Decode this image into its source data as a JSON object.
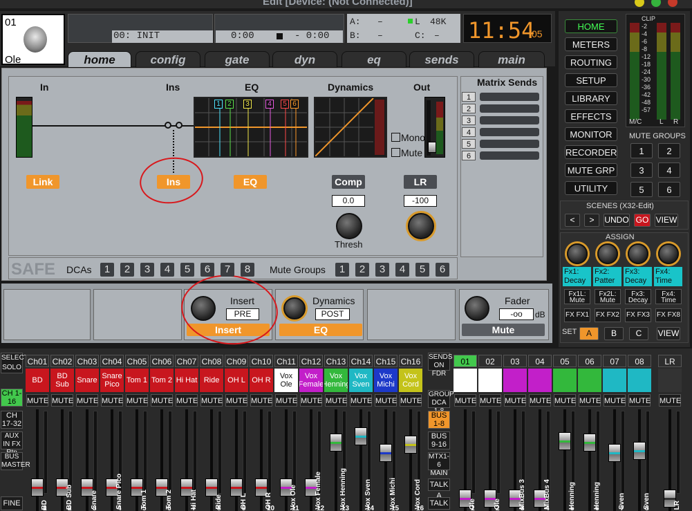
{
  "window": {
    "title": "Edit [Device: (Not Connected)]"
  },
  "channel": {
    "number": "01",
    "name": "Ole"
  },
  "display": {
    "scene": "00: INIT",
    "time_left": "0:00",
    "time_right": "- 0:00",
    "a_label": "A:",
    "a_value": "–",
    "b_label": "B:",
    "b_value": "–",
    "l_label": "L",
    "rate": "48K",
    "c_label": "C:",
    "c_value": "–",
    "clock": "11:54",
    "clock_sec": "05"
  },
  "tabs": [
    "home",
    "config",
    "gate",
    "dyn",
    "eq",
    "sends",
    "main"
  ],
  "home": {
    "in": "In",
    "ins": "Ins",
    "eq": "EQ",
    "dynamics": "Dynamics",
    "out": "Out",
    "link_btn": "Link",
    "ins_btn": "Ins",
    "eq_btn": "EQ",
    "mono": "Mono",
    "mute": "Mute",
    "comp_btn": "Comp",
    "comp_val": "0.0",
    "thresh": "Thresh",
    "lr_btn": "LR",
    "lr_val": "-100",
    "eq_bands": [
      "1",
      "2",
      "3",
      "4",
      "5",
      "6"
    ],
    "safe": "SAFE",
    "dcas_label": "DCAs",
    "dcas": [
      "1",
      "2",
      "3",
      "4",
      "5",
      "6",
      "7",
      "8"
    ],
    "mute_groups_label": "Mute Groups",
    "mute_groups": [
      "1",
      "2",
      "3",
      "4",
      "5",
      "6"
    ]
  },
  "matrix": {
    "title": "Matrix Sends",
    "items": [
      "1",
      "2",
      "3",
      "4",
      "5",
      "6"
    ]
  },
  "strip_bar": {
    "insert_title": "Insert",
    "insert_mode": "PRE",
    "insert_btn": "Insert",
    "dyn_title": "Dynamics",
    "dyn_mode": "POST",
    "dyn_btn": "EQ",
    "fader_title": "Fader",
    "fader_val": "-oo",
    "fader_unit": "dB",
    "mute_btn": "Mute"
  },
  "sidebar": {
    "buttons": [
      "HOME",
      "METERS",
      "ROUTING",
      "SETUP",
      "LIBRARY",
      "EFFECTS",
      "MONITOR",
      "RECORDER",
      "MUTE GRP",
      "UTILITY"
    ],
    "clip": "CLIP",
    "meter_ticks": [
      "-2",
      "-4",
      "-6",
      "-8",
      "-12",
      "-18",
      "-24",
      "-30",
      "-36",
      "-42",
      "-48",
      "-57"
    ],
    "meter_labels": [
      "M/C",
      "L",
      "R"
    ],
    "mute_groups_title": "MUTE GROUPS",
    "mute_groups": [
      "1",
      "2",
      "3",
      "4",
      "5",
      "6"
    ],
    "scenes_title": "SCENES (X32-Edit)",
    "scene_btns": [
      "<",
      ">",
      "UNDO",
      "GO",
      "VIEW"
    ],
    "assign_title": "ASSIGN",
    "fx_labels": [
      "Fx1: Decay",
      "Fx2: Patter",
      "Fx3: Decay",
      "Fx4: Time"
    ],
    "fx_small": [
      "Fx1L: Mute",
      "Fx2L: Mute",
      "Fx3: Decay",
      "Fx4: Time"
    ],
    "fx_btns": [
      "FX FX1",
      "FX FX2",
      "FX FX3",
      "FX FX8"
    ],
    "set_label": "SET",
    "set_btns": [
      "A",
      "B",
      "C"
    ],
    "set_view": "VIEW"
  },
  "mixer_left": {
    "select_solo": "SELECT SOLO",
    "ch1_16": "CH 1-16",
    "ch17_32": "CH 17-32",
    "aux": "AUX IN FX Rtn",
    "bus_master": "BUS MASTER",
    "fine": "FINE"
  },
  "mixer_center": {
    "sends_on_fdr": "SENDS ON FDR",
    "group_dca": "GROUP DCA 1-8",
    "bus_1_8": "BUS 1-8",
    "bus_9_16": "BUS 9-16",
    "mtx": "MTX1-6 MAIN C",
    "talk_a": "TALK A",
    "talk_b": "TALK B"
  },
  "mute_label": "MUTE",
  "channels": [
    {
      "id": "Ch01",
      "name": "BD",
      "v": "BD",
      "c": "#c8161e",
      "n": "1",
      "f": 0.15
    },
    {
      "id": "Ch02",
      "name": "BD Sub",
      "v": "BD Sub",
      "c": "#c8161e",
      "n": "2",
      "f": 0.15
    },
    {
      "id": "Ch03",
      "name": "Snare",
      "v": "Snare",
      "c": "#c8161e",
      "n": "3",
      "f": 0.15
    },
    {
      "id": "Ch04",
      "name": "Snare Pico",
      "v": "Snare Pico",
      "c": "#c8161e",
      "n": "4",
      "f": 0.15
    },
    {
      "id": "Ch05",
      "name": "Tom 1",
      "v": "Tom 1",
      "c": "#c8161e",
      "n": "5",
      "f": 0.15
    },
    {
      "id": "Ch06",
      "name": "Tom 2",
      "v": "Tom 2",
      "c": "#c8161e",
      "n": "6",
      "f": 0.15
    },
    {
      "id": "Ch07",
      "name": "Hi Hat",
      "v": "Hi Hat",
      "c": "#c8161e",
      "n": "7",
      "f": 0.15
    },
    {
      "id": "Ch08",
      "name": "Ride",
      "v": "Ride",
      "c": "#c8161e",
      "n": "8",
      "f": 0.15
    },
    {
      "id": "Ch09",
      "name": "OH L",
      "v": "OH L",
      "c": "#c8161e",
      "n": "9",
      "f": 0.15
    },
    {
      "id": "Ch10",
      "name": "OH R",
      "v": "OH R",
      "c": "#c8161e",
      "n": "10",
      "f": 0.15
    },
    {
      "id": "Ch11",
      "name": "Vox Ole",
      "v": "Vox Ole",
      "c": "#ffffff",
      "n": "11",
      "f": 0.15
    },
    {
      "id": "Ch12",
      "name": "Vox Female",
      "v": "Vox Female",
      "c": "#c21fc9",
      "n": "12",
      "f": 0.15
    },
    {
      "id": "Ch13",
      "name": "Vox Henning",
      "v": "Vox Henning",
      "c": "#33b83c",
      "n": "13",
      "f": 0.7
    },
    {
      "id": "Ch14",
      "name": "Vox Sven",
      "v": "Vox Sven",
      "c": "#1fb8c4",
      "n": "14",
      "f": 0.78
    },
    {
      "id": "Ch15",
      "name": "Vox Michi",
      "v": "Vox Michi",
      "c": "#1d39c9",
      "n": "15",
      "f": 0.58
    },
    {
      "id": "Ch16",
      "name": "Vox Cord",
      "v": "Vox Cord",
      "c": "#c4c31a",
      "n": "16",
      "f": 0.68
    }
  ],
  "buses": [
    {
      "id": "01",
      "v": "Ole",
      "c": "#ffffff",
      "n": "1",
      "f": 0.02
    },
    {
      "id": "02",
      "v": "Ole",
      "c": "#ffffff",
      "n": "2",
      "f": 0.02
    },
    {
      "id": "03",
      "v": "MixBus 3",
      "c": "#c21fc9",
      "n": "3",
      "f": 0.02
    },
    {
      "id": "04",
      "v": "MixBus 4",
      "c": "#c21fc9",
      "n": "4",
      "f": 0.02
    },
    {
      "id": "05",
      "v": "Henning",
      "c": "#33b83c",
      "n": "5",
      "f": 0.72
    },
    {
      "id": "06",
      "v": "Henning",
      "c": "#33b83c",
      "n": "6",
      "f": 0.7
    },
    {
      "id": "07",
      "v": "Sven",
      "c": "#1fb8c4",
      "n": "7",
      "f": 0.58
    },
    {
      "id": "08",
      "v": "Sven",
      "c": "#1fb8c4",
      "n": "8",
      "f": 0.6
    }
  ],
  "lr": {
    "id": "LR",
    "v": "LR",
    "n": ""
  },
  "accent": {
    "orange": "#f0962b",
    "green": "#44ff55",
    "red": "#d8181c"
  }
}
